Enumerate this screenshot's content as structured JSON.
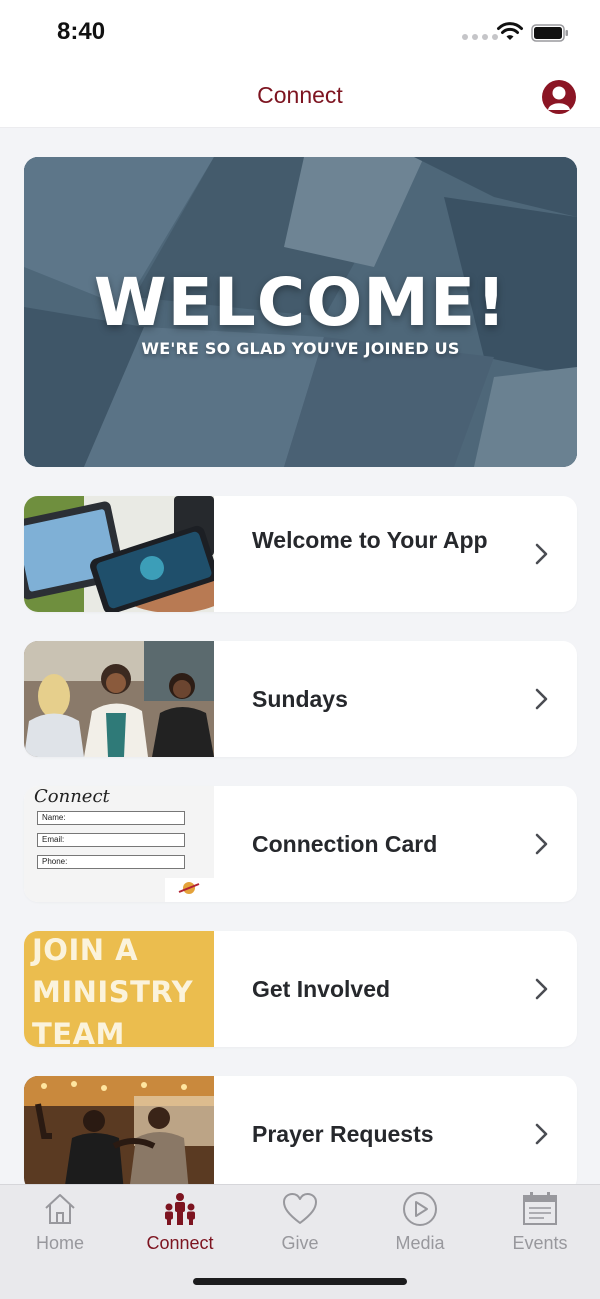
{
  "status_bar": {
    "time": "8:40"
  },
  "header": {
    "title": "Connect"
  },
  "hero": {
    "headline": "WELCOME!",
    "subline": "WE'RE SO GLAD YOU'VE JOINED US"
  },
  "list": {
    "items": [
      {
        "label": "Welcome to Your App",
        "thumb": "phone-tablet-photo"
      },
      {
        "label": "Sundays",
        "thumb": "people-talking-photo"
      },
      {
        "label": "Connection Card",
        "thumb": "connect-form-image"
      },
      {
        "label": "Get Involved",
        "thumb": "join-ministry-team-graphic"
      },
      {
        "label": "Prayer Requests",
        "thumb": "prayer-group-photo"
      }
    ]
  },
  "connect_card_thumb": {
    "title": "Connect",
    "field_name": "Name:",
    "field_email": "Email:",
    "field_phone": "Phone:"
  },
  "ministry_thumb": {
    "line1": "JOIN A",
    "line2": "MINISTRY",
    "line3": "TEAM"
  },
  "tabs": [
    {
      "label": "Home",
      "icon": "home-icon",
      "active": false
    },
    {
      "label": "Connect",
      "icon": "people-icon",
      "active": true
    },
    {
      "label": "Give",
      "icon": "heart-icon",
      "active": false
    },
    {
      "label": "Media",
      "icon": "play-icon",
      "active": false
    },
    {
      "label": "Events",
      "icon": "calendar-icon",
      "active": false
    }
  ],
  "colors": {
    "brand": "#7d1420",
    "background": "#f3f4f7",
    "tab_inactive": "#98989d"
  }
}
